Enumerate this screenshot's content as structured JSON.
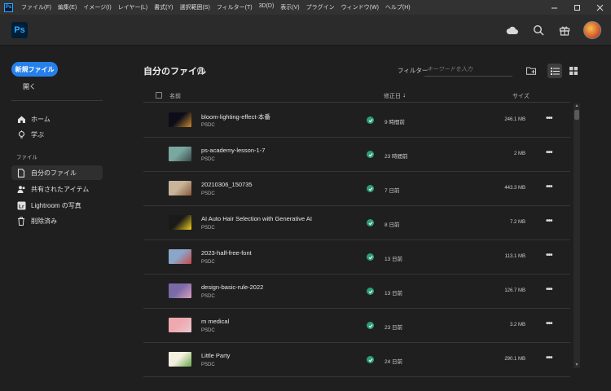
{
  "menubar": {
    "app_icon": "Ps",
    "items": [
      "ファイル(F)",
      "編集(E)",
      "イメージ(I)",
      "レイヤー(L)",
      "書式(Y)",
      "選択範囲(S)",
      "フィルター(T)",
      "3D(D)",
      "表示(V)",
      "プラグイン",
      "ウィンドウ(W)",
      "ヘルプ(H)"
    ]
  },
  "header": {
    "logo": "Ps",
    "icons": [
      "cloud-icon",
      "search-icon",
      "gift-icon",
      "avatar"
    ]
  },
  "sidebar": {
    "new_file": "新規ファイル",
    "open": "開く",
    "nav": [
      {
        "label": "ホーム",
        "icon": "home-icon"
      },
      {
        "label": "学ぶ",
        "icon": "lightbulb-icon"
      }
    ],
    "section_label": "ファイル",
    "files_nav": [
      {
        "label": "自分のファイル",
        "icon": "file-icon",
        "active": true
      },
      {
        "label": "共有されたアイテム",
        "icon": "people-icon",
        "active": false
      },
      {
        "label": "Lightroom の写真",
        "icon": "lightroom-icon",
        "active": false
      },
      {
        "label": "削除済み",
        "icon": "trash-icon",
        "active": false
      }
    ]
  },
  "main": {
    "title": "自分のファイル",
    "help": "?",
    "filter_label": "フィルター",
    "filter_placeholder": "キーワードを入力",
    "columns": {
      "name": "名前",
      "modified": "修正日",
      "size": "サイズ"
    },
    "sort_arrow": "↓"
  },
  "files": [
    {
      "name": "bloom-lighting-effect-本番",
      "type": "PSDC",
      "modified": "9 時間前",
      "size": "246.1 MB",
      "thumb": [
        "#0d0d1a",
        "#c98a2a"
      ]
    },
    {
      "name": "ps-academy-lesson-1-7",
      "type": "PSDC",
      "modified": "23 時間前",
      "size": "2 MB",
      "thumb": [
        "#7aa7a0",
        "#3a4a4a"
      ]
    },
    {
      "name": "20210306_150735",
      "type": "PSDC",
      "modified": "7 日前",
      "size": "443.3 MB",
      "thumb": [
        "#c9b49a",
        "#8a5a3a"
      ]
    },
    {
      "name": "AI Auto Hair Selection with Generative AI",
      "type": "PSDC",
      "modified": "8 日前",
      "size": "7.2 MB",
      "thumb": [
        "#1a1a1a",
        "#f2d21e"
      ]
    },
    {
      "name": "2023-half-free-font",
      "type": "PSDC",
      "modified": "13 日前",
      "size": "113.1 MB",
      "thumb": [
        "#8aa6c9",
        "#c94a4a"
      ]
    },
    {
      "name": "design-basic-rule-2022",
      "type": "PSDC",
      "modified": "13 日前",
      "size": "126.7 MB",
      "thumb": [
        "#7a6aa8",
        "#d9a0c0"
      ]
    },
    {
      "name": "m medical",
      "type": "PSDC",
      "modified": "23 日前",
      "size": "3.2 MB",
      "thumb": [
        "#f0a8b0",
        "#e8c8d0"
      ]
    },
    {
      "name": "Little Party",
      "type": "PSDC",
      "modified": "24 日前",
      "size": "290.1 MB",
      "thumb": [
        "#f4f0e0",
        "#6aa84a"
      ]
    }
  ],
  "more_label": "•••",
  "colors": {
    "accent": "#2680eb",
    "sync": "#2d9d78",
    "ps_blue": "#31a8ff"
  }
}
